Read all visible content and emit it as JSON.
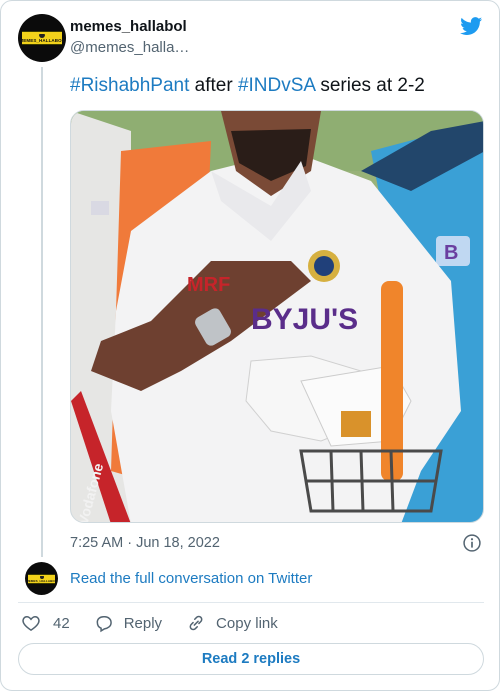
{
  "author": {
    "name": "memes_hallabol",
    "handle": "@memes_halla…",
    "avatar_text": "MEMES_HALLABOL"
  },
  "tweet": {
    "parts": [
      {
        "text": "#RishabhPant",
        "type": "hashtag"
      },
      {
        "text": " after ",
        "type": "text"
      },
      {
        "text": "#INDvSA",
        "type": "hashtag"
      },
      {
        "text": " series at 2-2",
        "type": "text"
      }
    ],
    "image_logos": [
      "BYJU'S",
      "MRF",
      "Vodafone"
    ]
  },
  "meta": {
    "timestamp": "7:25 AM · Jun 18, 2022"
  },
  "conversation_link": "Read the full conversation on Twitter",
  "actions": {
    "like_count": "42",
    "reply_label": "Reply",
    "copy_label": "Copy link"
  },
  "read_replies": "Read 2 replies",
  "colors": {
    "link": "#1d7bc1",
    "muted": "#536471",
    "border": "#cfd9de",
    "twitter_blue": "#1d9bf0",
    "avatar_yellow": "#f2d21b"
  },
  "icons": [
    "twitter-bird-icon",
    "info-icon",
    "heart-icon",
    "reply-icon",
    "link-icon"
  ]
}
